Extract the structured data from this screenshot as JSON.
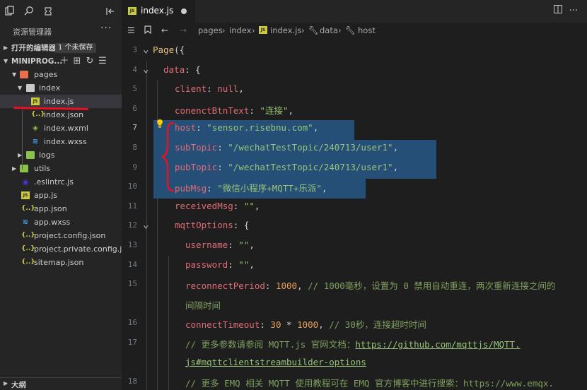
{
  "toolbar": {
    "icons": [
      "files-icon",
      "search-icon",
      "extensions-icon",
      "collapse-panel-icon"
    ]
  },
  "sidebar": {
    "title": "资源管理器",
    "more": "···",
    "open_editors": {
      "label": "打开的编辑器",
      "badge": "1 个未保存"
    },
    "project": {
      "label": "MINIPROG..."
    },
    "tree": [
      {
        "name": "pages",
        "kind": "folder-red",
        "open": true
      },
      {
        "name": "index",
        "kind": "folder-open",
        "open": true
      },
      {
        "name": "index.js",
        "kind": "js",
        "selected": true
      },
      {
        "name": "index.json",
        "kind": "json"
      },
      {
        "name": "index.wxml",
        "kind": "wxml"
      },
      {
        "name": "index.wxss",
        "kind": "wxss"
      },
      {
        "name": "logs",
        "kind": "folder-green",
        "open": false
      },
      {
        "name": "utils",
        "kind": "folder-green",
        "open": false
      },
      {
        "name": ".eslintrc.js",
        "kind": "eslint"
      },
      {
        "name": "app.js",
        "kind": "js"
      },
      {
        "name": "app.json",
        "kind": "json"
      },
      {
        "name": "app.wxss",
        "kind": "wxss"
      },
      {
        "name": "project.config.json",
        "kind": "json"
      },
      {
        "name": "project.private.config.js...",
        "kind": "json"
      },
      {
        "name": "sitemap.json",
        "kind": "json"
      }
    ],
    "outline": "大纲"
  },
  "tab": {
    "name": "index.js",
    "icon_text": "JS"
  },
  "breadcrumb": [
    "pages",
    "index",
    "index.js",
    "data",
    "host"
  ],
  "code": {
    "lines": [
      {
        "no": "3",
        "tokens": [
          [
            "k-fn",
            "Page"
          ],
          [
            "",
            "({"
          ]
        ]
      },
      {
        "no": "4",
        "tokens": [
          [
            "k-key",
            "data"
          ],
          [
            "",
            ": {"
          ]
        ]
      },
      {
        "no": "5",
        "tokens": [
          [
            "k-key",
            "client"
          ],
          [
            "",
            ": "
          ],
          [
            "k-nul",
            "null"
          ],
          [
            "",
            ","
          ]
        ]
      },
      {
        "no": "6",
        "tokens": [
          [
            "k-key",
            "conenctBtnText"
          ],
          [
            "",
            ": "
          ],
          [
            "k-str",
            "\"连接\""
          ],
          [
            "",
            ","
          ]
        ]
      },
      {
        "no": "7",
        "tokens": [
          [
            "k-key",
            "host"
          ],
          [
            "",
            ": "
          ],
          [
            "k-str",
            "\"sensor.risebnu.com\""
          ],
          [
            "",
            ","
          ]
        ]
      },
      {
        "no": "8",
        "tokens": [
          [
            "k-key",
            "subTopic"
          ],
          [
            "",
            ": "
          ],
          [
            "k-str",
            "\"/wechatTestTopic/240713/user1\""
          ],
          [
            "",
            ","
          ]
        ]
      },
      {
        "no": "9",
        "tokens": [
          [
            "k-key",
            "pubTopic"
          ],
          [
            "",
            ": "
          ],
          [
            "k-str",
            "\"/wechatTestTopic/240713/user1\""
          ],
          [
            "",
            ","
          ]
        ]
      },
      {
        "no": "10",
        "tokens": [
          [
            "k-key",
            "pubMsg"
          ],
          [
            "",
            ": "
          ],
          [
            "k-str",
            "\"微信小程序+MQTT+乐派\""
          ],
          [
            "",
            ","
          ]
        ]
      },
      {
        "no": "11",
        "tokens": [
          [
            "k-key",
            "receivedMsg"
          ],
          [
            "",
            ": "
          ],
          [
            "k-str",
            "\"\""
          ],
          [
            "",
            ","
          ]
        ]
      },
      {
        "no": "12",
        "tokens": [
          [
            "k-key",
            "mqttOptions"
          ],
          [
            "",
            ": {"
          ]
        ]
      },
      {
        "no": "13",
        "tokens": [
          [
            "k-key",
            "username"
          ],
          [
            "",
            ": "
          ],
          [
            "k-str",
            "\"\""
          ],
          [
            "",
            ","
          ]
        ]
      },
      {
        "no": "14",
        "tokens": [
          [
            "k-key",
            "password"
          ],
          [
            "",
            ": "
          ],
          [
            "k-str",
            "\"\""
          ],
          [
            "",
            ","
          ]
        ]
      },
      {
        "no": "15",
        "tokens": [
          [
            "k-key",
            "reconnectPeriod"
          ],
          [
            "",
            ": "
          ],
          [
            "k-num",
            "1000"
          ],
          [
            "",
            ", "
          ],
          [
            "k-cmt",
            "// 1000毫秒，设置为 0 禁用自动重连，两次重新连接之间的"
          ]
        ]
      },
      {
        "no": "",
        "tokens": [
          [
            "k-cmt",
            "间隔时间"
          ]
        ]
      },
      {
        "no": "16",
        "tokens": [
          [
            "k-key",
            "connectTimeout"
          ],
          [
            "",
            ": "
          ],
          [
            "k-num",
            "30"
          ],
          [
            "",
            " * "
          ],
          [
            "k-num",
            "1000"
          ],
          [
            "",
            ", "
          ],
          [
            "k-cmt",
            "// 30秒，连接超时时间"
          ]
        ]
      },
      {
        "no": "17",
        "tokens": [
          [
            "k-cmt",
            "// 更多参数请参阅 MQTT.js 官网文档："
          ],
          [
            "k-url",
            "https://github.com/mqttjs/MQTT."
          ]
        ]
      },
      {
        "no": "",
        "tokens": [
          [
            "k-url",
            "js#mqttclientstreambuilder-options"
          ]
        ]
      },
      {
        "no": "18",
        "tokens": [
          [
            "k-cmt",
            "// 更多 EMQ 相关 MQTT 使用教程可在 EMQ 官方博客中进行搜索：https://www.emqx."
          ]
        ]
      }
    ]
  },
  "colors": {
    "accent": "#264f78",
    "annotation": "#e81123"
  }
}
